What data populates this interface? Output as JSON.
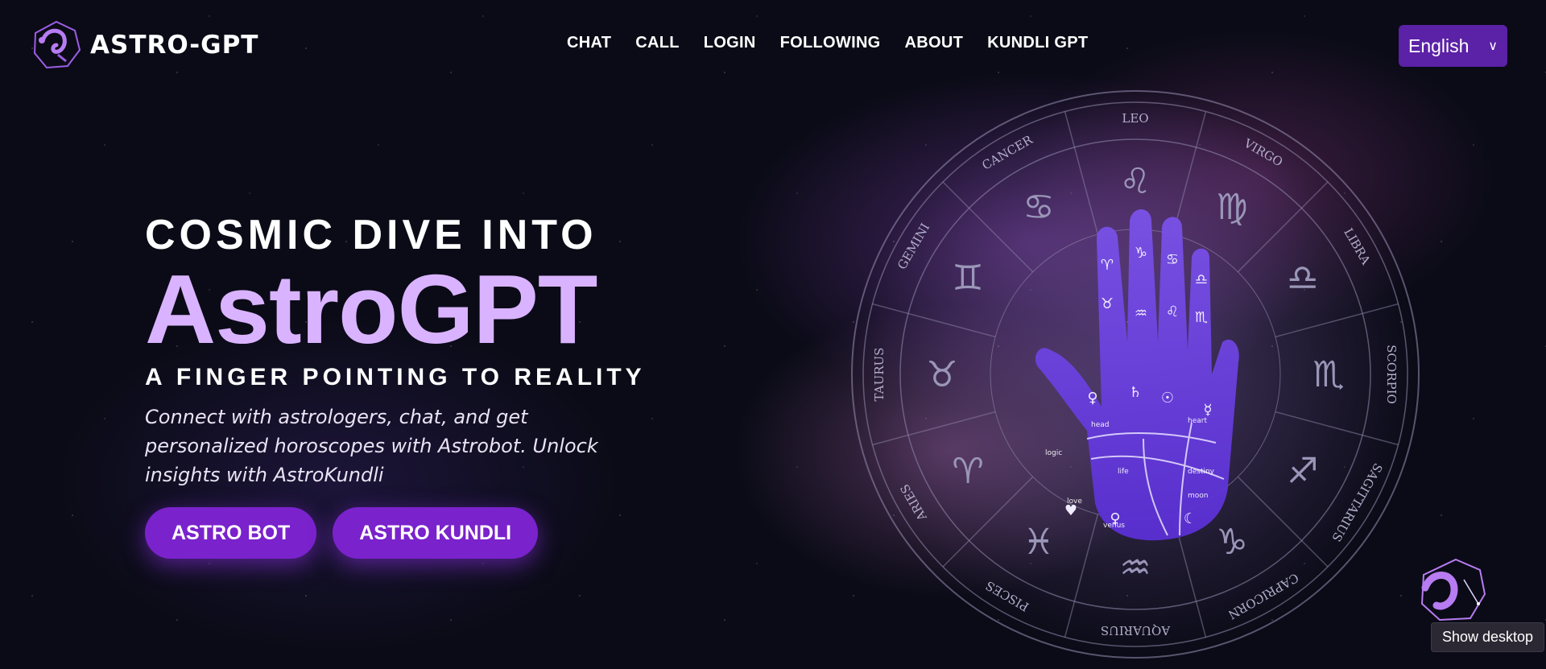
{
  "brand": {
    "name": "ASTRO-GPT",
    "logo_icon": "scorpion-logo-icon"
  },
  "nav": {
    "items": [
      "CHAT",
      "CALL",
      "LOGIN",
      "FOLLOWING",
      "ABOUT",
      "KUNDLI GPT"
    ]
  },
  "language_select": {
    "value": "English",
    "icon": "chevron-down-icon"
  },
  "hero": {
    "eyebrow": "COSMIC DIVE INTO",
    "title": "AstroGPT",
    "tagline": "A FINGER POINTING TO REALITY",
    "description": "Connect with astrologers, chat, and get personalized horoscopes with Astrobot. Unlock insights with AstroKundli",
    "buttons": {
      "astro_bot": "ASTRO BOT",
      "astro_kundli": "ASTRO KUNDLI"
    }
  },
  "zodiac_wheel": {
    "signs": [
      "LEO",
      "VIRGO",
      "LIBRA",
      "SCORPIO",
      "SAGITTARIUS",
      "CAPRICORN",
      "AQUARIUS",
      "PISCES",
      "ARIES",
      "TAURUS",
      "GEMINI",
      "CANCER"
    ],
    "symbols": [
      "♌",
      "♍",
      "♎",
      "♏",
      "♐",
      "♑",
      "♒",
      "♓",
      "♈",
      "♉",
      "♊",
      "♋"
    ],
    "palm_labels": {
      "head": "head",
      "heart": "heart",
      "logic": "logic",
      "life": "life",
      "destiny": "destiny",
      "love": "love",
      "moon": "moon",
      "venus": "venus"
    }
  },
  "tooltip": {
    "text": "Show desktop"
  },
  "colors": {
    "accent": "#7a22cc",
    "title": "#d9b3ff",
    "select_bg": "#5b21a6",
    "background": "#0b0b17"
  }
}
